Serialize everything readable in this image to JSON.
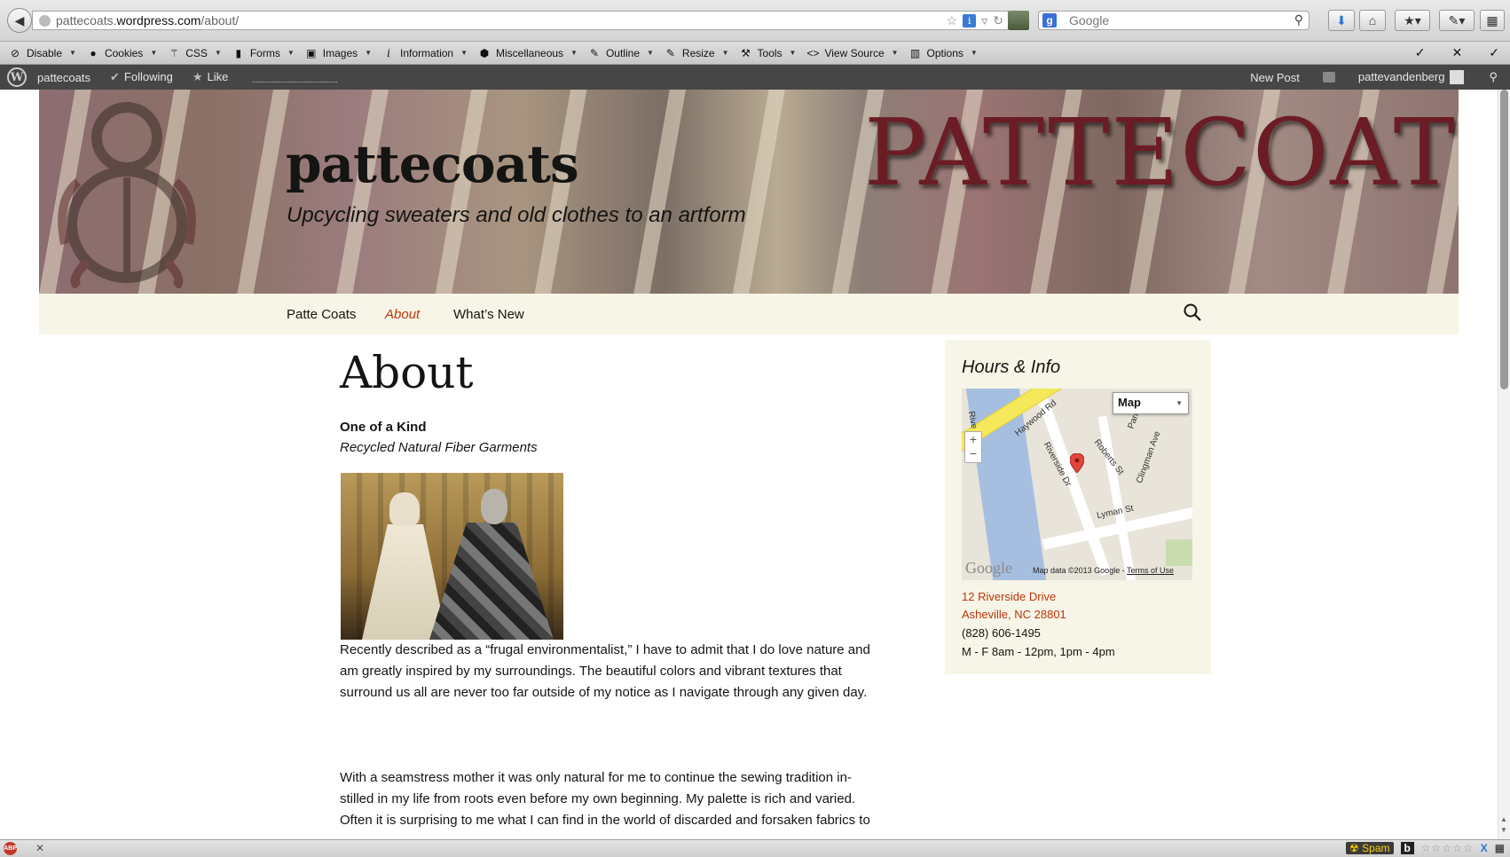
{
  "browser": {
    "url_prefix": "pattecoats.",
    "url_domain": "wordpress.com",
    "url_path": "/about/",
    "search_engine_placeholder": "Google"
  },
  "devbar": {
    "items": [
      {
        "label": "Disable",
        "icon": "disable-icon"
      },
      {
        "label": "Cookies",
        "icon": "person-icon"
      },
      {
        "label": "CSS",
        "icon": "wand-icon"
      },
      {
        "label": "Forms",
        "icon": "forms-icon"
      },
      {
        "label": "Images",
        "icon": "images-icon"
      },
      {
        "label": "Information",
        "icon": "info-icon"
      },
      {
        "label": "Miscellaneous",
        "icon": "cube-icon"
      },
      {
        "label": "Outline",
        "icon": "pencil-icon"
      },
      {
        "label": "Resize",
        "icon": "resize-icon"
      },
      {
        "label": "Tools",
        "icon": "wrench-icon"
      },
      {
        "label": "View Source",
        "icon": "code-icon"
      },
      {
        "label": "Options",
        "icon": "grid-icon"
      }
    ]
  },
  "adminbar": {
    "site": "pattecoats",
    "following": "Following",
    "like": "Like",
    "new_post": "New Post",
    "user": "pattevandenberg"
  },
  "header": {
    "title": "pattecoats",
    "description": "Upcycling sweaters and old clothes to an artform",
    "logo_text": "PATTECOATS"
  },
  "nav": {
    "items": [
      "Patte Coats",
      "About",
      "What’s New"
    ],
    "current": "About"
  },
  "content": {
    "title": "About",
    "lead": "One of a Kind",
    "lead_sub": "Recycled Natural Fiber Garments",
    "paragraph1_line1": "Recently described as a “frugal environmentalist,” I have to admit that I do love nature and",
    "paragraph1_line2": "am greatly inspired by my surroundings.  The beautiful colors and vibrant textures that",
    "paragraph1_line3": "surround us all are never too far outside of my notice as I navigate through any given day.",
    "paragraph2_line1": "With a seamstress mother it was only natural for me to continue the sewing tradition in-",
    "paragraph2_line2": "stilled in my life from roots even before my own beginning.  My palette is rich and varied.",
    "paragraph2_line3": "Often it is surprising to me what I can find in the world of discarded and forsaken fabrics to"
  },
  "widget": {
    "title": "Hours & Info",
    "map_type": "Map",
    "map_streets": {
      "haywood": "Haywood Rd",
      "riverside": "Riverside Dr",
      "roberts": "Roberts St",
      "clingman": "Clingman Ave",
      "lyman": "Lyman St",
      "park": "Park",
      "river": "Rive"
    },
    "google_logo": "Google",
    "map_credit": "Map data ©2013 Google - ",
    "terms": "Terms of Use",
    "address1": "12 Riverside Drive",
    "address2": "Asheville, NC 28801",
    "phone": "(828) 606-1495",
    "hours": "M - F 8am - 12pm, 1pm - 4pm"
  },
  "statusbar": {
    "abp": "ABP",
    "spam": "Spam",
    "b": "b"
  },
  "colors": {
    "accent": "#bc360a",
    "nav_bg": "#f7f5e7",
    "adminbar_bg": "#464646"
  }
}
